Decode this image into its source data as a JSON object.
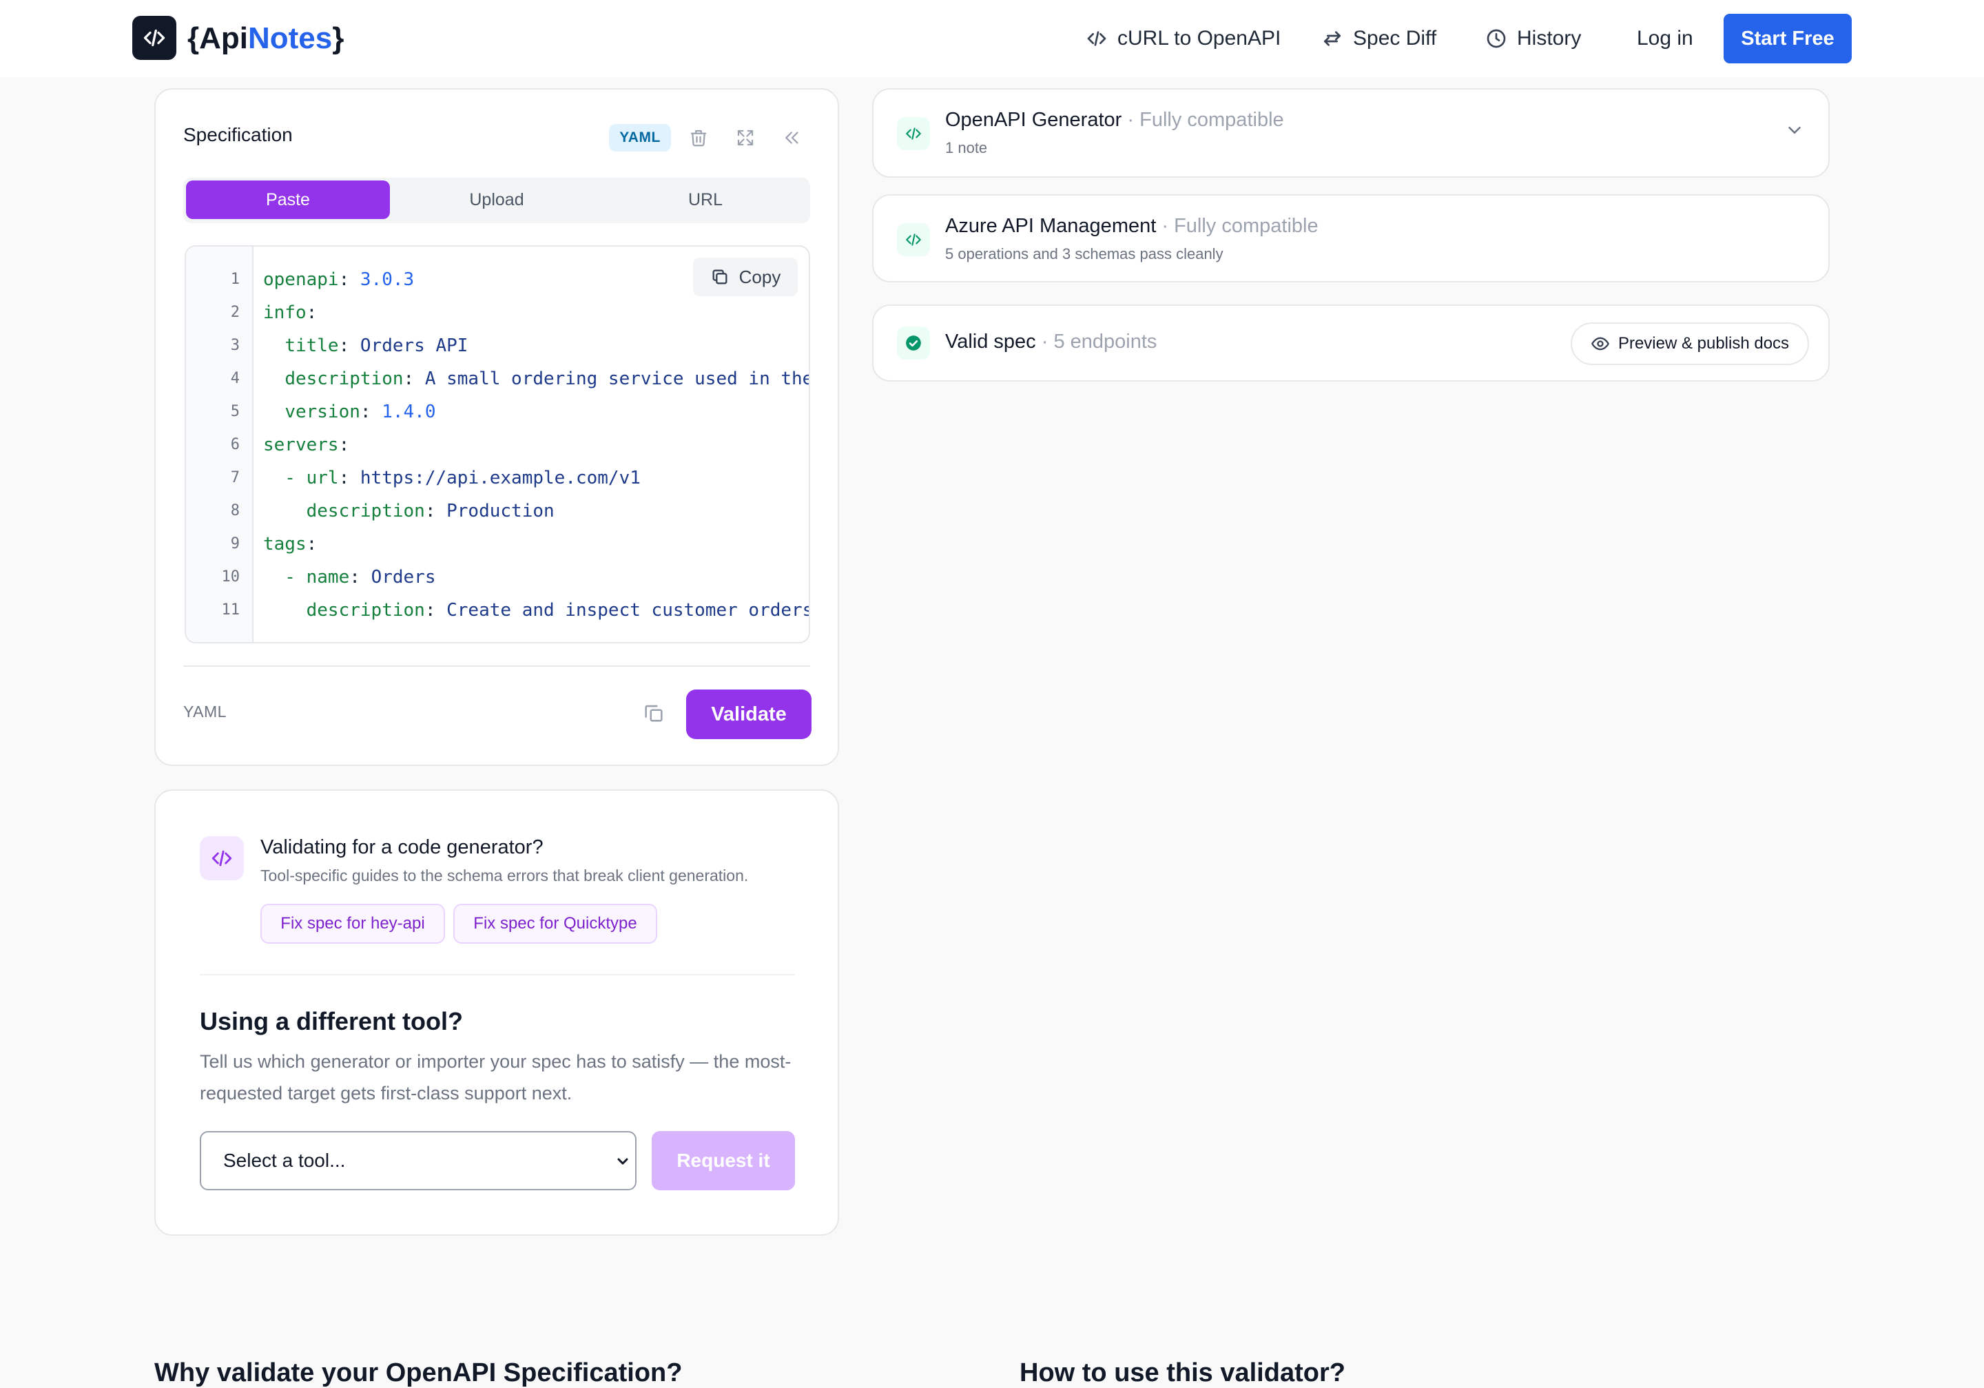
{
  "nav": {
    "logo_open": "{Api",
    "logo_accent": "Notes",
    "logo_close": "}",
    "links": [
      "cURL to OpenAPI",
      "Spec Diff",
      "History"
    ],
    "login": "Log in",
    "start": "Start Free"
  },
  "spec": {
    "title": "Specification",
    "format_badge": "YAML",
    "tabs": [
      "Paste",
      "Upload",
      "URL"
    ],
    "active_tab": "Paste",
    "copy_label": "Copy",
    "line_numbers": [
      "1",
      "2",
      "3",
      "4",
      "5",
      "6",
      "7",
      "8",
      "9",
      "10",
      "11"
    ],
    "code": [
      {
        "indent": "",
        "key": "openapi",
        "value": "3.0.3",
        "numeric": true
      },
      {
        "indent": "",
        "key": "info",
        "value": ""
      },
      {
        "indent": "  ",
        "key": "title",
        "value": "Orders API"
      },
      {
        "indent": "  ",
        "key": "description",
        "value": "A small ordering service used in the"
      },
      {
        "indent": "  ",
        "key": "version",
        "value": "1.4.0",
        "numeric": true
      },
      {
        "indent": "",
        "key": "servers",
        "value": ""
      },
      {
        "indent": "  - ",
        "key": "url",
        "value": "https://api.example.com/v1"
      },
      {
        "indent": "    ",
        "key": "description",
        "value": "Production"
      },
      {
        "indent": "",
        "key": "tags",
        "value": ""
      },
      {
        "indent": "  - ",
        "key": "name",
        "value": "Orders"
      },
      {
        "indent": "    ",
        "key": "description",
        "value": "Create and inspect customer orders"
      }
    ],
    "footer_lang": "YAML",
    "validate": "Validate"
  },
  "guide": {
    "title": "Validating for a code generator?",
    "subtitle": "Tool-specific guides to the schema errors that break client generation.",
    "chips": [
      "Fix spec for hey-api",
      "Fix spec for Quicktype"
    ],
    "tool_title": "Using a different tool?",
    "tool_desc": "Tell us which generator or importer your spec has to satisfy — the most-requested target gets first-class support next.",
    "select_value": "Select a tool...",
    "request": "Request it"
  },
  "results": [
    {
      "title": "OpenAPI Generator",
      "status": "Fully compatible",
      "sub": "1 note"
    },
    {
      "title": "Azure API Management",
      "status": "Fully compatible",
      "sub": "5 operations and 3 schemas pass cleanly"
    }
  ],
  "valid": {
    "title": "Valid spec",
    "detail": "5 endpoints",
    "preview": "Preview & publish docs"
  },
  "bottom": {
    "left_heading": "Why validate your OpenAPI Specification?",
    "right_heading": "How to use this validator?"
  },
  "colors": {
    "accent_purple": "#9333ea",
    "brand_blue": "#2563eb",
    "success_green": "#059669"
  }
}
